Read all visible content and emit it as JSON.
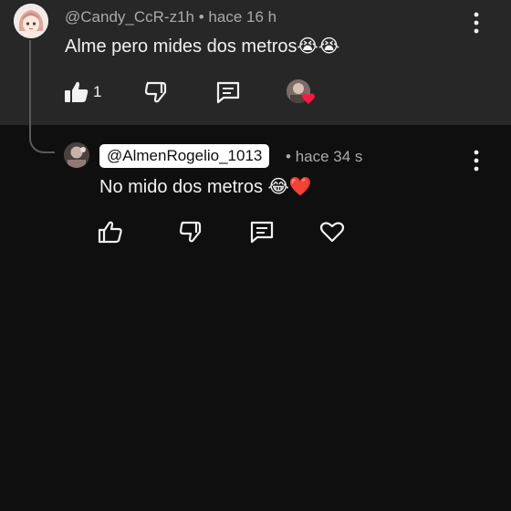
{
  "comment": {
    "author": "@Candy_CcR-z1h",
    "time": "hace 16 h",
    "separator": "•",
    "text": "Alme pero mides dos metros",
    "text_emoji": "😭😭",
    "like_count": "1",
    "icons": {
      "like": "thumbs-up-filled-icon",
      "dislike": "thumbs-down-icon",
      "reply": "reply-icon",
      "creator_heart": "creator-heart-badge"
    }
  },
  "reply": {
    "mention": "@AlmenRogelio_1013",
    "time": "hace 34 s",
    "separator": "•",
    "text": "No mido dos metros",
    "text_emoji": "😂❤️",
    "icons": {
      "like": "thumbs-up-icon",
      "dislike": "thumbs-down-icon",
      "reply": "reply-icon",
      "heart": "heart-icon"
    }
  },
  "colors": {
    "background": "#0f0f0f",
    "highlight": "#272727",
    "secondary_text": "#aaaaaa",
    "heart_red": "#ff1744"
  }
}
